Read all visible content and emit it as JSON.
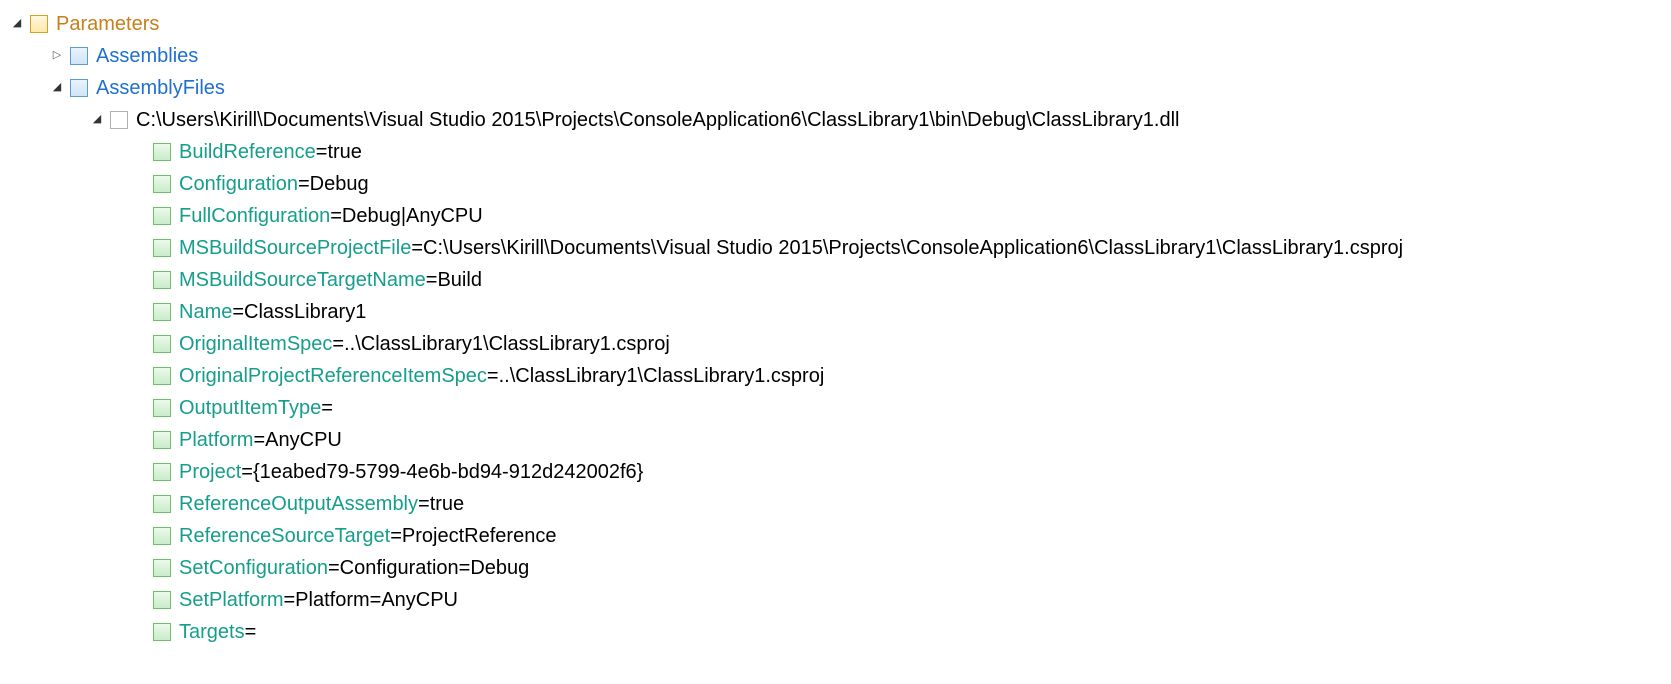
{
  "root": {
    "label": "Parameters"
  },
  "children": [
    {
      "label": "Assemblies"
    },
    {
      "label": "AssemblyFiles"
    }
  ],
  "filePath": "C:\\Users\\Kirill\\Documents\\Visual Studio 2015\\Projects\\ConsoleApplication6\\ClassLibrary1\\bin\\Debug\\ClassLibrary1.dll",
  "props": [
    {
      "k": "BuildReference",
      "v": "true"
    },
    {
      "k": "Configuration",
      "v": "Debug"
    },
    {
      "k": "FullConfiguration",
      "v": "Debug|AnyCPU"
    },
    {
      "k": "MSBuildSourceProjectFile",
      "v": "C:\\Users\\Kirill\\Documents\\Visual Studio 2015\\Projects\\ConsoleApplication6\\ClassLibrary1\\ClassLibrary1.csproj"
    },
    {
      "k": "MSBuildSourceTargetName",
      "v": "Build"
    },
    {
      "k": "Name",
      "v": "ClassLibrary1"
    },
    {
      "k": "OriginalItemSpec",
      "v": "..\\ClassLibrary1\\ClassLibrary1.csproj"
    },
    {
      "k": "OriginalProjectReferenceItemSpec",
      "v": "..\\ClassLibrary1\\ClassLibrary1.csproj"
    },
    {
      "k": "OutputItemType",
      "v": ""
    },
    {
      "k": "Platform",
      "v": "AnyCPU"
    },
    {
      "k": "Project",
      "v": "{1eabed79-5799-4e6b-bd94-912d242002f6}"
    },
    {
      "k": "ReferenceOutputAssembly",
      "v": "true"
    },
    {
      "k": "ReferenceSourceTarget",
      "v": "ProjectReference"
    },
    {
      "k": "SetConfiguration",
      "v": "Configuration=Debug"
    },
    {
      "k": "SetPlatform",
      "v": "Platform=AnyCPU"
    },
    {
      "k": "Targets",
      "v": ""
    }
  ]
}
